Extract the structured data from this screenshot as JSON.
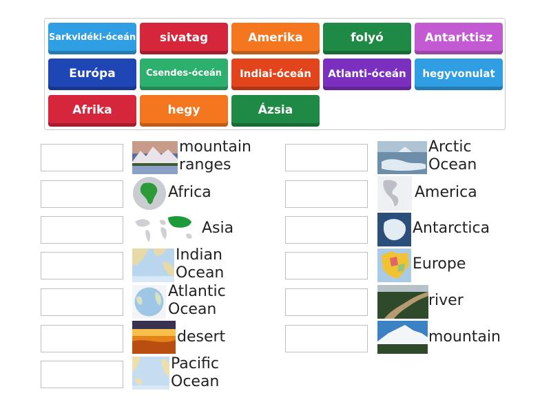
{
  "tiles": [
    {
      "label": "Sarkvidéki-óceán",
      "color": "#2f9ee3"
    },
    {
      "label": "sivatag",
      "color": "#d6263c"
    },
    {
      "label": "Amerika",
      "color": "#f4761f"
    },
    {
      "label": "folyó",
      "color": "#1f8a45"
    },
    {
      "label": "Antarktisz",
      "color": "#c45ad2"
    },
    {
      "label": "Európa",
      "color": "#1f46b5"
    },
    {
      "label": "Csendes-óceán",
      "color": "#2daf6e"
    },
    {
      "label": "Indiai-óceán",
      "color": "#e2451c"
    },
    {
      "label": "Atlanti-óceán",
      "color": "#7b2fbf"
    },
    {
      "label": "hegyvonulat",
      "color": "#2f9ee3"
    },
    {
      "label": "Afrika",
      "color": "#d6263c"
    },
    {
      "label": "hegy",
      "color": "#f4761f"
    },
    {
      "label": "Ázsia",
      "color": "#1f8a45"
    }
  ],
  "left_items": [
    {
      "line1": "mountain",
      "line2": "ranges",
      "icon": "mountain-ranges-photo"
    },
    {
      "line1": "Africa",
      "line2": "",
      "icon": "africa-globe-map"
    },
    {
      "line1": "Asia",
      "line2": "",
      "icon": "asia-world-map"
    },
    {
      "line1": "Indian",
      "line2": "Ocean",
      "icon": "indian-ocean-map"
    },
    {
      "line1": "Atlantic",
      "line2": "Ocean",
      "icon": "atlantic-ocean-globe"
    },
    {
      "line1": "desert",
      "line2": "",
      "icon": "desert-photo"
    },
    {
      "line1": "Pacific",
      "line2": "Ocean",
      "icon": "pacific-ocean-map"
    }
  ],
  "right_items": [
    {
      "line1": "Arctic",
      "line2": "Ocean",
      "icon": "arctic-ocean-photo"
    },
    {
      "line1": "America",
      "line2": "",
      "icon": "america-map"
    },
    {
      "line1": "Antarctica",
      "line2": "",
      "icon": "antarctica-map"
    },
    {
      "line1": "Europe",
      "line2": "",
      "icon": "europe-map"
    },
    {
      "line1": "river",
      "line2": "",
      "icon": "river-photo"
    },
    {
      "line1": "mountain",
      "line2": "",
      "icon": "mountain-photo"
    }
  ]
}
